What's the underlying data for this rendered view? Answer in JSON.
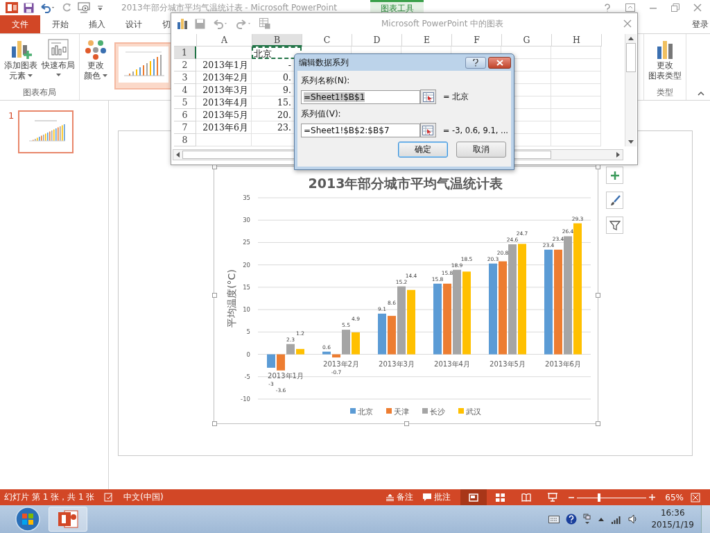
{
  "title_bar": {
    "title": "2013年部分城市平均气温统计表 - Microsoft PowerPoint",
    "context_tab": "图表工具"
  },
  "ribbon_tabs": [
    {
      "label": "文件",
      "kind": "file",
      "selected": false
    },
    {
      "label": "开始",
      "kind": "tab",
      "selected": false
    },
    {
      "label": "插入",
      "kind": "tab",
      "selected": false
    },
    {
      "label": "设计",
      "kind": "tab",
      "selected": false
    },
    {
      "label": "切",
      "kind": "tab",
      "selected": false
    }
  ],
  "account": "登录",
  "ribbon_groups": [
    {
      "label": "图表布局",
      "buttons": [
        {
          "kind": "add-element",
          "lines": [
            "添加图表",
            "元素"
          ],
          "dropdown": true
        },
        {
          "kind": "layout",
          "lines": [
            "快速布局"
          ],
          "dropdown": true
        }
      ]
    },
    {
      "buttons": [
        {
          "kind": "colors",
          "lines": [
            "更改",
            "颜色"
          ],
          "dropdown": true
        }
      ],
      "gallery": {
        "selected": true
      }
    }
  ],
  "ribbon_right": {
    "label": "类型",
    "buttons": [
      {
        "kind": "chart-type",
        "lines": [
          "更改",
          "图表类型"
        ],
        "dropdown": false
      }
    ]
  },
  "slides": [
    {
      "number": "1",
      "selected": true
    }
  ],
  "chart_window": {
    "title": "Microsoft PowerPoint 中的图表",
    "columns": [
      {
        "label": "A",
        "selected": false
      },
      {
        "label": "B",
        "selected": true
      },
      {
        "label": "C",
        "selected": false
      },
      {
        "label": "D",
        "selected": false
      },
      {
        "label": "E",
        "selected": false
      },
      {
        "label": "F",
        "selected": false
      },
      {
        "label": "G",
        "selected": false
      },
      {
        "label": "H",
        "selected": false
      }
    ],
    "rows": [
      {
        "label": "1",
        "selected": true,
        "b": "北京",
        "copy_marquee": true
      },
      {
        "label": "2",
        "selected": false,
        "a": "2013年1月",
        "b": "-",
        "copy_marquee": false
      },
      {
        "label": "3",
        "selected": false,
        "a": "2013年2月",
        "b": "0.",
        "copy_marquee": false
      },
      {
        "label": "4",
        "selected": false,
        "a": "2013年3月",
        "b": "9.",
        "copy_marquee": false
      },
      {
        "label": "5",
        "selected": false,
        "a": "2013年4月",
        "b": "15.",
        "copy_marquee": false
      },
      {
        "label": "6",
        "selected": false,
        "a": "2013年5月",
        "b": "20.",
        "copy_marquee": false
      },
      {
        "label": "7",
        "selected": false,
        "a": "2013年6月",
        "b": "23.",
        "copy_marquee": false
      },
      {
        "label": "8",
        "selected": false,
        "copy_marquee": false
      }
    ]
  },
  "dialog": {
    "title": "编辑数据系列",
    "fields": [
      {
        "label": "系列名称(N):",
        "value": "=Sheet1!$B$1",
        "text_selected": true,
        "preview": "= 北京"
      },
      {
        "label": "系列值(V):",
        "value": "=Sheet1!$B$2:$B$7",
        "text_selected": false,
        "preview": "= -3, 0.6, 9.1, ..."
      }
    ],
    "buttons": [
      {
        "label": "确定",
        "default": true
      },
      {
        "label": "取消",
        "default": false
      }
    ]
  },
  "chart": {
    "chart_data": {
      "type": "bar",
      "title": "2013年部分城市平均气温统计表",
      "ylabel": "平均温度(°C)",
      "categories": [
        "2013年1月",
        "2013年2月",
        "2013年3月",
        "2013年4月",
        "2013年5月",
        "2013年6月"
      ],
      "series": [
        {
          "name": "北京",
          "color": "#5b9bd5",
          "values": [
            -3,
            0.6,
            9.1,
            15.8,
            20.3,
            23.4
          ]
        },
        {
          "name": "天津",
          "color": "#ed7d31",
          "values": [
            -3.6,
            -0.7,
            8.6,
            15.8,
            20.8,
            23.4
          ]
        },
        {
          "name": "长沙",
          "color": "#a5a5a5",
          "values": [
            2.3,
            5.5,
            15.2,
            18.9,
            24.6,
            26.4
          ]
        },
        {
          "name": "武汉",
          "color": "#ffc000",
          "values": [
            1.2,
            4.9,
            14.4,
            18.5,
            24.7,
            29.3
          ]
        }
      ],
      "ylim": [
        -10,
        35
      ],
      "yticks": [
        -10,
        -5,
        0,
        5,
        10,
        15,
        20,
        25,
        30,
        35
      ],
      "data_labels": true,
      "grid": true,
      "legend": true
    },
    "side_buttons": [
      {
        "kind": "add"
      },
      {
        "kind": "style"
      },
      {
        "kind": "filter"
      }
    ]
  },
  "status_bar": {
    "slide_info": "幻灯片 第 1 张，共 1 张",
    "language": "中文(中国)",
    "notes": "备注",
    "comments": "批注",
    "views": [
      {
        "kind": "normal",
        "selected": true
      },
      {
        "kind": "sorter",
        "selected": false
      },
      {
        "kind": "reading",
        "selected": false
      },
      {
        "kind": "slideshow",
        "selected": false
      }
    ],
    "zoom": {
      "level": 0.32,
      "reading": "65%"
    }
  },
  "taskbar": {
    "apps": [
      {
        "kind": "powerpoint",
        "selected": true
      }
    ],
    "time": "16:36",
    "date": "2015/1/19"
  }
}
